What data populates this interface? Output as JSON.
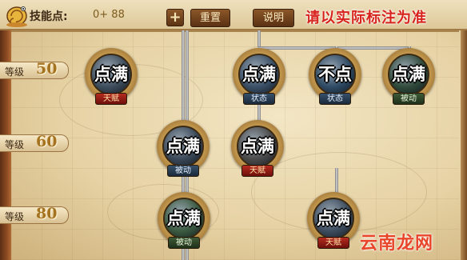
{
  "topbar": {
    "skill_points_label": "技能点:",
    "skill_points_value": "0+ 88",
    "plus_label": "+",
    "reset_label": "重置",
    "help_label": "说明",
    "note": "请以实际标注为准"
  },
  "levels": [
    {
      "text": "等级",
      "num": "50"
    },
    {
      "text": "等级",
      "num": "60"
    },
    {
      "text": "等级",
      "num": "80"
    }
  ],
  "nodes": [
    {
      "text": "点满",
      "badge": "天赋",
      "badge_color": "red",
      "disc_color": "#3e4d5c"
    },
    {
      "text": "点满",
      "badge": "状态",
      "badge_color": "blue",
      "disc_color": "#3a4f66"
    },
    {
      "text": "不点",
      "badge": "状态",
      "badge_color": "blue",
      "disc_color": "#2e4a64"
    },
    {
      "text": "点满",
      "badge": "被动",
      "badge_color": "green",
      "disc_color": "#2f4a3a"
    },
    {
      "text": "点满",
      "badge": "被动",
      "badge_color": "blue",
      "disc_color": "#3a4858"
    },
    {
      "text": "点满",
      "badge": "天赋",
      "badge_color": "red",
      "disc_color": "#4a4a4a"
    },
    {
      "text": "点满",
      "badge": "被动",
      "badge_color": "green",
      "disc_color": "#3b5a40"
    },
    {
      "text": "点满",
      "badge": "天赋",
      "badge_color": "red",
      "disc_color": "#3d4c5e"
    }
  ],
  "watermark": {
    "text": "云南龙网",
    "sub": ""
  },
  "colors": {
    "note_red": "#d8231d",
    "level_gold": "#a5731f",
    "watermark": "#e8452a"
  },
  "icons": {
    "snail": "snail-mascot-icon",
    "plus": "plus-icon"
  }
}
